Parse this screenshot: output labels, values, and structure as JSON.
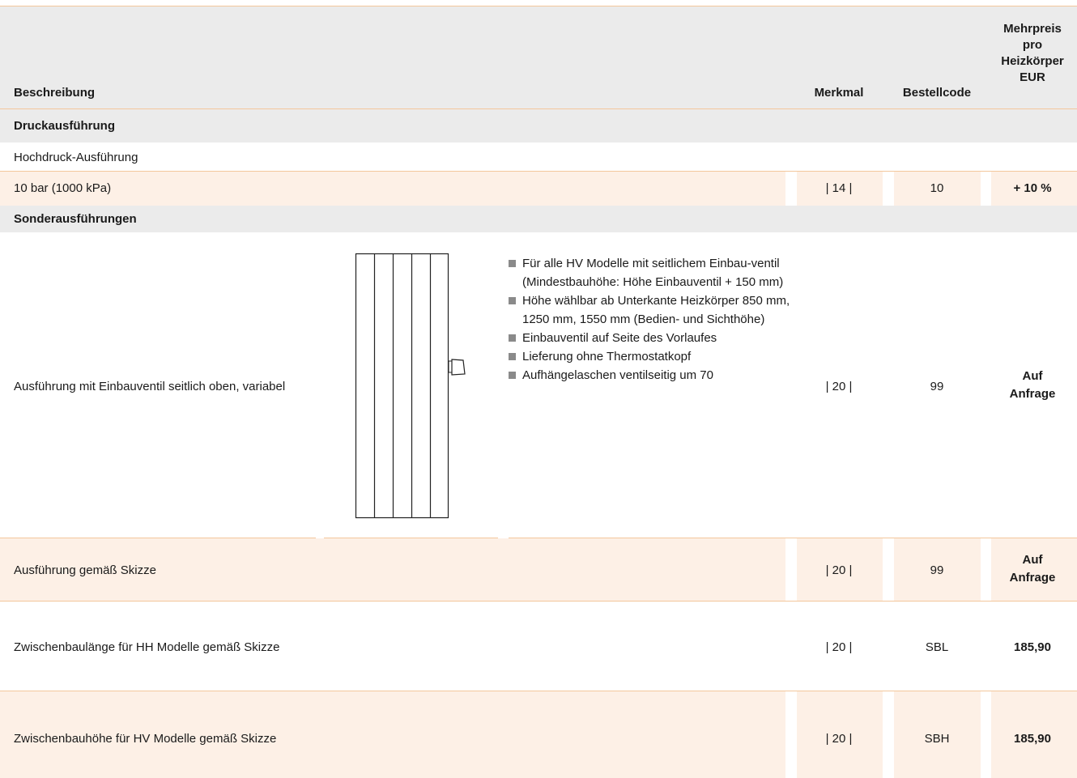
{
  "header": {
    "beschreibung": "Beschreibung",
    "merkmal": "Merkmal",
    "bestellcode": "Bestellcode",
    "price_lines": [
      "Mehrpreis",
      "pro",
      "Heizkörper",
      "EUR"
    ]
  },
  "sections": {
    "druck": "Druckausführung",
    "sonder": "Sonderausführungen"
  },
  "rows": {
    "hochdruck": {
      "label": "Hochdruck-Ausführung"
    },
    "bar10": {
      "label": "10 bar (1000 kPa)",
      "merkmal": "| 14 |",
      "code": "10",
      "price": "+ 10 %"
    },
    "einbau": {
      "label": "Ausführung mit Einbauventil seitlich oben, variabel",
      "merkmal": "| 20 |",
      "code": "99",
      "price_lines": [
        "Auf",
        "Anfrage"
      ],
      "bullets": [
        "Für alle HV Modelle mit seitlichem Einbau-ventil (Mindestbauhöhe: Höhe Einbauventil + 150 mm)",
        "Höhe wählbar ab Unterkante Heizkörper 850 mm, 1250 mm, 1550 mm (Bedien- und Sichthöhe)",
        "Einbauventil auf Seite des Vorlaufes",
        "Lieferung ohne Thermostatkopf",
        "Aufhängelaschen ventilseitig um 70"
      ]
    },
    "skizze": {
      "label": "Ausführung gemäß Skizze",
      "merkmal": "| 20 |",
      "code": "99",
      "price_lines": [
        "Auf",
        "Anfrage"
      ]
    },
    "sbl": {
      "label": "Zwischenbaulänge für HH Modelle gemäß Skizze",
      "merkmal": "| 20 |",
      "code": "SBL",
      "price": "185,90"
    },
    "sbh": {
      "label": "Zwischenbauhöhe für HV Modelle gemäß Skizze",
      "merkmal": "| 20 |",
      "code": "SBH",
      "price": "185,90"
    }
  },
  "colors": {
    "accent_line": "#f3c79c",
    "row_tint": "#fdf0e6",
    "header_bg": "#ebebeb"
  }
}
